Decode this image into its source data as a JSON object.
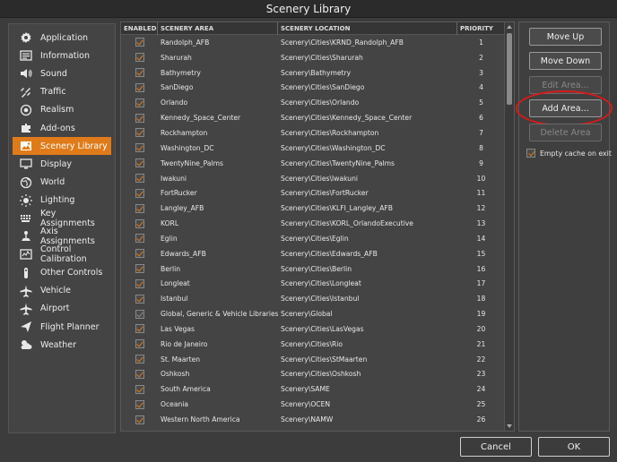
{
  "window": {
    "title": "Scenery Library"
  },
  "sidebar": {
    "items": [
      {
        "label": "Application",
        "icon": "application-icon",
        "name": "application"
      },
      {
        "label": "Information",
        "icon": "information-icon",
        "name": "information"
      },
      {
        "label": "Sound",
        "icon": "sound-icon",
        "name": "sound"
      },
      {
        "label": "Traffic",
        "icon": "traffic-icon",
        "name": "traffic"
      },
      {
        "label": "Realism",
        "icon": "realism-icon",
        "name": "realism"
      },
      {
        "label": "Add-ons",
        "icon": "addons-icon",
        "name": "addons"
      },
      {
        "label": "Scenery Library",
        "icon": "scenery-library-icon",
        "name": "scenery-library",
        "active": true
      },
      {
        "label": "Display",
        "icon": "display-icon",
        "name": "display"
      },
      {
        "label": "World",
        "icon": "world-icon",
        "name": "world"
      },
      {
        "label": "Lighting",
        "icon": "lighting-icon",
        "name": "lighting"
      },
      {
        "label": "Key Assignments",
        "icon": "keyboard-icon",
        "name": "key-assignments"
      },
      {
        "label": "Axis Assignments",
        "icon": "joystick-icon",
        "name": "axis-assignments"
      },
      {
        "label": "Control Calibration",
        "icon": "calibration-icon",
        "name": "control-calibration"
      },
      {
        "label": "Other Controls",
        "icon": "other-controls-icon",
        "name": "other-controls"
      },
      {
        "label": "Vehicle",
        "icon": "vehicle-icon",
        "name": "vehicle"
      },
      {
        "label": "Airport",
        "icon": "airport-icon",
        "name": "airport"
      },
      {
        "label": "Flight Planner",
        "icon": "flight-planner-icon",
        "name": "flight-planner"
      },
      {
        "label": "Weather",
        "icon": "weather-icon",
        "name": "weather"
      }
    ]
  },
  "table": {
    "headers": {
      "enabled": "ENABLED",
      "area": "SCENERY AREA",
      "location": "SCENERY LOCATION",
      "priority": "PRIORITY"
    },
    "rows": [
      {
        "area": "Randolph_AFB",
        "location": "Scenery\\Cities\\KRND_Randolph_AFB",
        "priority": "1",
        "enabled": true
      },
      {
        "area": "Sharurah",
        "location": "Scenery\\Cities\\Sharurah",
        "priority": "2",
        "enabled": true
      },
      {
        "area": "Bathymetry",
        "location": "Scenery\\Bathymetry",
        "priority": "3",
        "enabled": true
      },
      {
        "area": "SanDiego",
        "location": "Scenery\\Cities\\SanDiego",
        "priority": "4",
        "enabled": true
      },
      {
        "area": "Orlando",
        "location": "Scenery\\Cities\\Orlando",
        "priority": "5",
        "enabled": true
      },
      {
        "area": "Kennedy_Space_Center",
        "location": "Scenery\\Cities\\Kennedy_Space_Center",
        "priority": "6",
        "enabled": true
      },
      {
        "area": "Rockhampton",
        "location": "Scenery\\Cities\\Rockhampton",
        "priority": "7",
        "enabled": true
      },
      {
        "area": "Washington_DC",
        "location": "Scenery\\Cities\\Washington_DC",
        "priority": "8",
        "enabled": true
      },
      {
        "area": "TwentyNine_Palms",
        "location": "Scenery\\Cities\\TwentyNine_Palms",
        "priority": "9",
        "enabled": true
      },
      {
        "area": "Iwakuni",
        "location": "Scenery\\Cities\\Iwakuni",
        "priority": "10",
        "enabled": true
      },
      {
        "area": "FortRucker",
        "location": "Scenery\\Cities\\FortRucker",
        "priority": "11",
        "enabled": true
      },
      {
        "area": "Langley_AFB",
        "location": "Scenery\\Cities\\KLFI_Langley_AFB",
        "priority": "12",
        "enabled": true
      },
      {
        "area": "KORL",
        "location": "Scenery\\Cities\\KORL_OrlandoExecutive",
        "priority": "13",
        "enabled": true
      },
      {
        "area": "Eglin",
        "location": "Scenery\\Cities\\Eglin",
        "priority": "14",
        "enabled": true
      },
      {
        "area": "Edwards_AFB",
        "location": "Scenery\\Cities\\Edwards_AFB",
        "priority": "15",
        "enabled": true
      },
      {
        "area": "Berlin",
        "location": "Scenery\\Cities\\Berlin",
        "priority": "16",
        "enabled": true
      },
      {
        "area": "Longleat",
        "location": "Scenery\\Cities\\Longleat",
        "priority": "17",
        "enabled": true
      },
      {
        "area": "Istanbul",
        "location": "Scenery\\Cities\\Istanbul",
        "priority": "18",
        "enabled": true
      },
      {
        "area": "Global, Generic & Vehicle Libraries",
        "location": "Scenery\\Global",
        "priority": "19",
        "enabled": true,
        "grey": true
      },
      {
        "area": "Las Vegas",
        "location": "Scenery\\Cities\\LasVegas",
        "priority": "20",
        "enabled": true
      },
      {
        "area": "Rio de Janeiro",
        "location": "Scenery\\Cities\\Rio",
        "priority": "21",
        "enabled": true
      },
      {
        "area": "St. Maarten",
        "location": "Scenery\\Cities\\StMaarten",
        "priority": "22",
        "enabled": true
      },
      {
        "area": "Oshkosh",
        "location": "Scenery\\Cities\\Oshkosh",
        "priority": "23",
        "enabled": true
      },
      {
        "area": "South America",
        "location": "Scenery\\SAME",
        "priority": "24",
        "enabled": true
      },
      {
        "area": "Oceania",
        "location": "Scenery\\OCEN",
        "priority": "25",
        "enabled": true
      },
      {
        "area": "Western North America",
        "location": "Scenery\\NAMW",
        "priority": "26",
        "enabled": true
      }
    ]
  },
  "actions": {
    "move_up": "Move Up",
    "move_down": "Move Down",
    "edit_area": "Edit Area...",
    "add_area": "Add Area...",
    "delete_area": "Delete Area",
    "empty_cache": "Empty cache on exit"
  },
  "footer": {
    "cancel": "Cancel",
    "ok": "OK"
  },
  "colors": {
    "accent": "#e07b1a",
    "highlight_circle": "#d81a1a"
  }
}
